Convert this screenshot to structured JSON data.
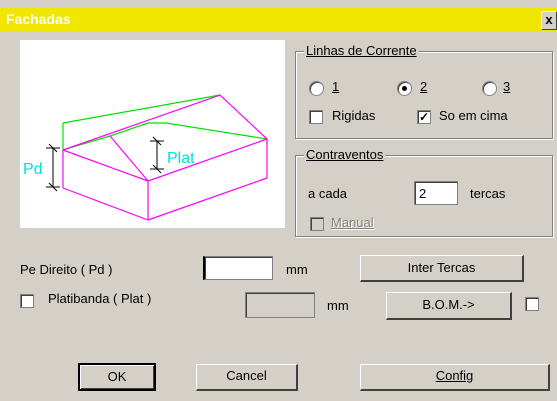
{
  "window": {
    "title": "Fachadas",
    "close_label": "x"
  },
  "preview": {
    "pd_label": "Pd",
    "plat_label": "Plat"
  },
  "linhas": {
    "title": "Linhas de Corrente",
    "radios": [
      {
        "label": "1",
        "selected": false
      },
      {
        "label": "2",
        "selected": true
      },
      {
        "label": "3",
        "selected": false
      }
    ],
    "rigidas": {
      "label": "Rigidas",
      "checked": false
    },
    "so_em_cima": {
      "label": "So em cima",
      "checked": true
    }
  },
  "contraventos": {
    "title": "Contraventos",
    "a_cada_label": "a cada",
    "value": "2",
    "tercas_label": "tercas",
    "manual": {
      "label": "Manual",
      "checked": false,
      "disabled": true
    }
  },
  "pe_direito": {
    "label": "Pe Direito ( Pd )",
    "value": "",
    "unit": "mm"
  },
  "platibanda": {
    "label": "Platibanda ( Plat )",
    "checked": false,
    "value": "",
    "unit": "mm"
  },
  "buttons": {
    "inter_tercas": "Inter Tercas",
    "bom": "B.O.M.->",
    "ok": "OK",
    "cancel": "Cancel",
    "config": "Config"
  },
  "colors": {
    "titlebar": "#f0e600",
    "walls": "#ff00ff",
    "parapet": "#00e000",
    "dimension_text": "#00e0e0"
  }
}
